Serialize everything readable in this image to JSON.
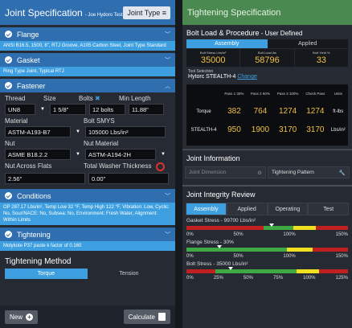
{
  "left": {
    "title": "Joint Specification",
    "subtitle": "- Joe Hydoro Test",
    "joint_type_btn": "Joint Type",
    "flange": {
      "label": "Flange",
      "desc": "ANSI B16.5, 1500, 8\", RTJ Groove, A105 Carbon Steel, Joint Type Standard"
    },
    "gasket": {
      "label": "Gasket",
      "desc": "Ring Type Joint, Typical RTJ"
    },
    "fastener": {
      "label": "Fastener",
      "thread_label": "Thread",
      "size_label": "Size",
      "bolts_label": "Bolts",
      "min_length_label": "Min Length",
      "thread_value": "UN8",
      "size_value": "1 5/8\"",
      "bolts_value": "12 bolts",
      "min_length_value": "11.88\"",
      "material_label": "Material",
      "bolt_smys_label": "Bolt SMYS",
      "material_value": "ASTM-A193-B7",
      "bolt_smys_value": "105000 Lbs/in²",
      "nut_label": "Nut",
      "nut_material_label": "Nut Material",
      "nut_value": "ASME B18.2.2",
      "nut_material_value": "ASTM-A194-2H",
      "naf_label": "Nut Across Flats",
      "twt_label": "Total Washer Thickness",
      "naf_value": "2.56\"",
      "twt_value": "0.00\""
    },
    "conditions": {
      "label": "Conditions",
      "desc": "OP 287.17 Lbs/in², Temp Low 32 °F, Temp High 122 °F, Vibration: Low, Cyclic: No, Sour/NACE: No, Subsea: No, Environment: Fresh Water, Alignment: Within Limits"
    },
    "tightening": {
      "label": "Tightening",
      "desc": "Molykote P37 paste k factor of 0.160"
    },
    "method_title": "Tightening Method",
    "method_torque": "Torque",
    "method_tension": "Tension",
    "new_btn": "New",
    "calculate_btn": "Calculate"
  },
  "right": {
    "title": "Tightening Specification",
    "blp_title": "Bolt Load & Procedure",
    "blp_sub": " - User Defined",
    "tab_assembly": "Assembly",
    "tab_applied": "Applied",
    "stats": [
      {
        "label": "Bolt Stress Lbs/in²",
        "value": "35000"
      },
      {
        "label": "Bolt Load lbs",
        "value": "58796"
      },
      {
        "label": "Bolt Yield %",
        "value": "33"
      }
    ],
    "tool_sel_label": "Tool Selection",
    "tool_sel_value": "Hytorc STEALTH-4",
    "tool_change": "Change",
    "pass_headers": [
      "",
      "Pass 1 30%",
      "Pass 2 60%",
      "Pass 3 100%",
      "Check Pass",
      "Units"
    ],
    "pass_rows": [
      [
        "Torque",
        "382",
        "764",
        "1274",
        "1274",
        "ft-lbs"
      ],
      [
        "STEALTH-4",
        "950",
        "1900",
        "3170",
        "3170",
        "Lbs/in²"
      ]
    ],
    "jinfo_title": "Joint Information",
    "jinfo_dim": "Joint Dimension",
    "jinfo_pattern": "Tightening Pattern",
    "jir_title": "Joint Integrity Review",
    "jir_tabs": [
      "Assembly",
      "Applied",
      "Operating",
      "Test"
    ],
    "gauges": [
      {
        "label": "Gasket Stress - 99700 Lbs/in²",
        "ticks": [
          "0%",
          "50%",
          "100%",
          "150%"
        ],
        "value_pct": 78
      },
      {
        "label": "Flange Stress - 30%",
        "ticks": [
          "0%",
          "50%",
          "100%",
          "150%"
        ],
        "value_pct": 30
      },
      {
        "label": "Bolt Stress - 35000 Lbs/in²",
        "ticks": [
          "0%",
          "25%",
          "50%",
          "75%",
          "100%",
          "125%"
        ],
        "value_pct": 33
      }
    ]
  }
}
